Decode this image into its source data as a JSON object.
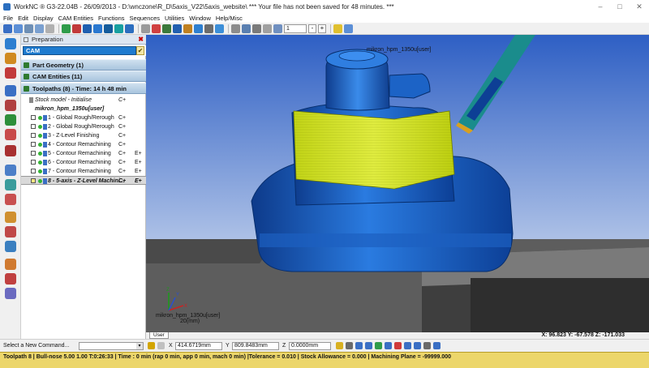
{
  "window": {
    "title": "WorkNC ® G3-22.04B - 26/09/2013 - D:\\wnczone\\R_D\\5axis_V22\\5axis_website\\ *** Your file has not been saved for 48 minutes. ***"
  },
  "menu": [
    "File",
    "Edit",
    "Display",
    "CAM Entities",
    "Functions",
    "Sequences",
    "Utilities",
    "Window",
    "Help/Misc"
  ],
  "toolbar": {
    "spin_value": "1",
    "minus": "-",
    "plus": "+"
  },
  "panel": {
    "header": "Preparation",
    "close": "✖",
    "selector": "CAM",
    "selector_check": "✔",
    "sections": [
      {
        "label": "Part Geometry (1)"
      },
      {
        "label": "CAM Entities (11)"
      },
      {
        "label": "Toolpaths (8) - Time: 14 h 48 min"
      }
    ],
    "stock": {
      "label": "Stock model - Initialise",
      "c1": "C+"
    },
    "machine": {
      "label": "mikron_hpm_1350u[user]"
    },
    "toolpaths": [
      {
        "label": "1 - Global Rough/Rerough",
        "c1": "C+",
        "c2": ""
      },
      {
        "label": "2 - Global Rough/Rerough",
        "c1": "C+",
        "c2": ""
      },
      {
        "label": "3 - Z-Level Finishing",
        "c1": "C+",
        "c2": ""
      },
      {
        "label": "4 - Contour Remachining",
        "c1": "C+",
        "c2": ""
      },
      {
        "label": "5 - Contour Remachining",
        "c1": "C+",
        "c2": "E+"
      },
      {
        "label": "6 - Contour Remachining",
        "c1": "C+",
        "c2": "E+"
      },
      {
        "label": "7 - Contour Remachining",
        "c1": "C+",
        "c2": "E+"
      },
      {
        "label": "8 - 5-axis - Z-Level Machini...",
        "c1": "C+",
        "c2": "E+"
      }
    ]
  },
  "viewport": {
    "machine_label_top": "mikron_hpm_1350u[user]",
    "machine_label_bottom": "mikron_hpm_1350u[user]",
    "triad_label": "20(mm)",
    "axis_z": "Z",
    "axis_y": "Y",
    "axis_x": "X",
    "tab": "User",
    "readout": "X: 96.823  Y: -67.578  Z: -171.033"
  },
  "status": {
    "command_label": "Select a New Command...",
    "x_label": "X",
    "x_value": "414.6719mm",
    "y_label": "Y",
    "y_value": "809.8483mm",
    "z_label": "Z",
    "z_value": "0.0000mm"
  },
  "bottom_bar": "Toolpath 8 | Bull-nose 5.00 1.00 T:0:26:33 | Time : 0 min (rap 0 min, app 0 min, mach 0 min) |Tolerance = 0.010 | Stock Allowance = 0.000 | Machining Plane = -99999.000"
}
